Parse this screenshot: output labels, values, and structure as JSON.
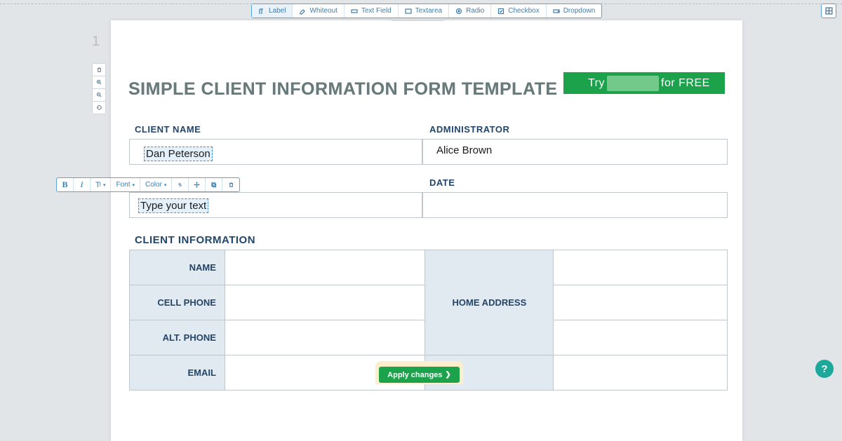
{
  "toolbar": {
    "label": "Label",
    "whiteout": "Whiteout",
    "text_field": "Text Field",
    "textarea": "Textarea",
    "radio": "Radio",
    "checkbox": "Checkbox",
    "dropdown": "Dropdown"
  },
  "page_number": "1",
  "doc": {
    "title": "SIMPLE CLIENT INFORMATION FORM TEMPLATE",
    "cta_prefix": "Try",
    "cta_suffix": "for FREE",
    "client_name_label": "CLIENT NAME",
    "administrator_label": "ADMINISTRATOR",
    "date_label": "DATE",
    "client_info_label": "CLIENT INFORMATION",
    "client_name_value": "Dan Peterson",
    "administrator_value": "Alice Brown",
    "typing_placeholder": "Type your text",
    "info_rows": {
      "name": "NAME",
      "cell": "CELL PHONE",
      "alt": "ALT. PHONE",
      "email": "EMAIL",
      "home": "HOME ADDRESS"
    }
  },
  "floatbar": {
    "bold": "B",
    "italic": "I",
    "textsize": "T",
    "font": "Font",
    "color": "Color"
  },
  "apply_label": "Apply changes",
  "help": "?"
}
